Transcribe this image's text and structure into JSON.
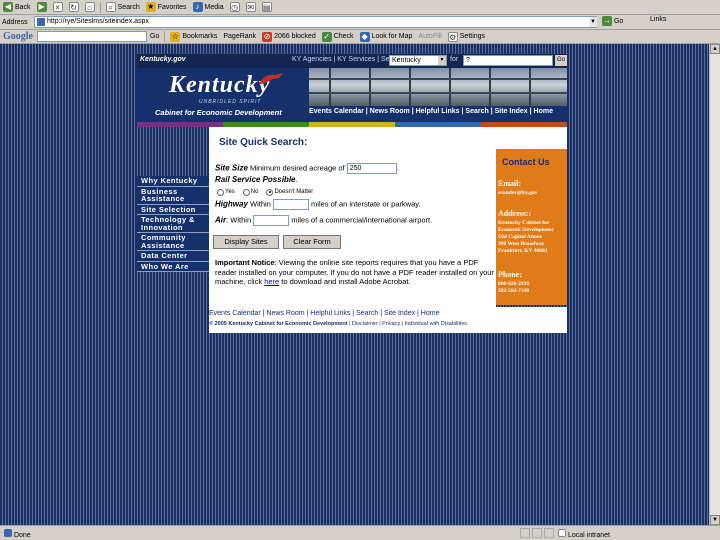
{
  "browser": {
    "toolbar": {
      "back": "Back",
      "search": "Search",
      "favorites": "Favorites",
      "media": "Media"
    },
    "address": {
      "label": "Address",
      "url": "http://rye/Siteslms/siteindex.aspx",
      "go": "Go",
      "links": "Links"
    },
    "google_bar": {
      "logo": "Google",
      "go": "Go",
      "bookmarks": "Bookmarks",
      "pagerank": "PageRank",
      "blocked": "2066 blocked",
      "check": "Check",
      "look_for_map": "Look for Map",
      "autofill": "AutoFill",
      "settings": "Settings"
    },
    "status": {
      "text": "Done",
      "zone": "Local intranet"
    }
  },
  "site": {
    "top": {
      "brand": "Kentucky.gov",
      "links": "KY Agencies  |  KY Services  |  Search",
      "select_value": "Kentucky",
      "for_label": "for",
      "search_value": "?",
      "go": "Go"
    },
    "logo": {
      "text": "Kentucky",
      "tagline": "UNBRIDLED SPIRIT",
      "cabinet": "Cabinet for Economic Development"
    },
    "nav": "Events Calendar  |  News Room  |  Helpful Links  |  Search  |  Site Index  |  Home",
    "colorbar": [
      "#7a2e86",
      "#3b8a2a",
      "#d8b21a",
      "#2f6bb5",
      "#c44c1a"
    ],
    "leftnav": [
      "Why Kentucky",
      "Business Assistance",
      "Site Selection",
      "Technology & Innovation",
      "Community Assistance",
      "Data Center",
      "Who We Are"
    ]
  },
  "form": {
    "title": "Site Quick Search:",
    "site_size_label": "Site Size",
    "site_size_text": "Minimum desired acreage of",
    "site_size_value": "250",
    "rail_label": "Rail Service Possible",
    "rail_options": [
      "Yes",
      "No",
      "Doesn't Matter"
    ],
    "rail_selected": 2,
    "highway_label": "Highway",
    "highway_within": "Within",
    "highway_text": "miles of an interstate or parkway.",
    "highway_value": "",
    "air_label": "Air",
    "air_within": "Within",
    "air_text": "miles of a commercial/international airport.",
    "air_value": "",
    "display_button": "Display Sites",
    "clear_button": "Clear Form",
    "notice_label": "Important Notice",
    "notice_text_1": ": Viewing the online site reports requires that you have a PDF reader installed on your computer. If you do not have a PDF reader installed on your machine, click ",
    "notice_link": "here",
    "notice_text_2": " to download and install Adobe Acrobat."
  },
  "contact": {
    "title": "Contact Us",
    "email_label": "Email:",
    "email_value": "econdev@ky.gov",
    "address_label": "Address::",
    "address_lines": [
      "Kentucky Cabinet for",
      "Economic Development",
      "Old Capitol Annex",
      "300 West Broadway",
      "Frankfort, KY 40601"
    ],
    "phone_label": "Phone:",
    "phone_lines": [
      "800-626-2930",
      "502-564-7140"
    ]
  },
  "footer": {
    "links": "Events Calendar  |  News Room  |  Helpful Links  |  Search  |  Site Index  |  Home",
    "copyright": "© 2005 Kentucky Cabinet for Economic Development",
    "legal": "  |  Disclaimer  |  Privacy  |  Individual with Disabilities"
  }
}
